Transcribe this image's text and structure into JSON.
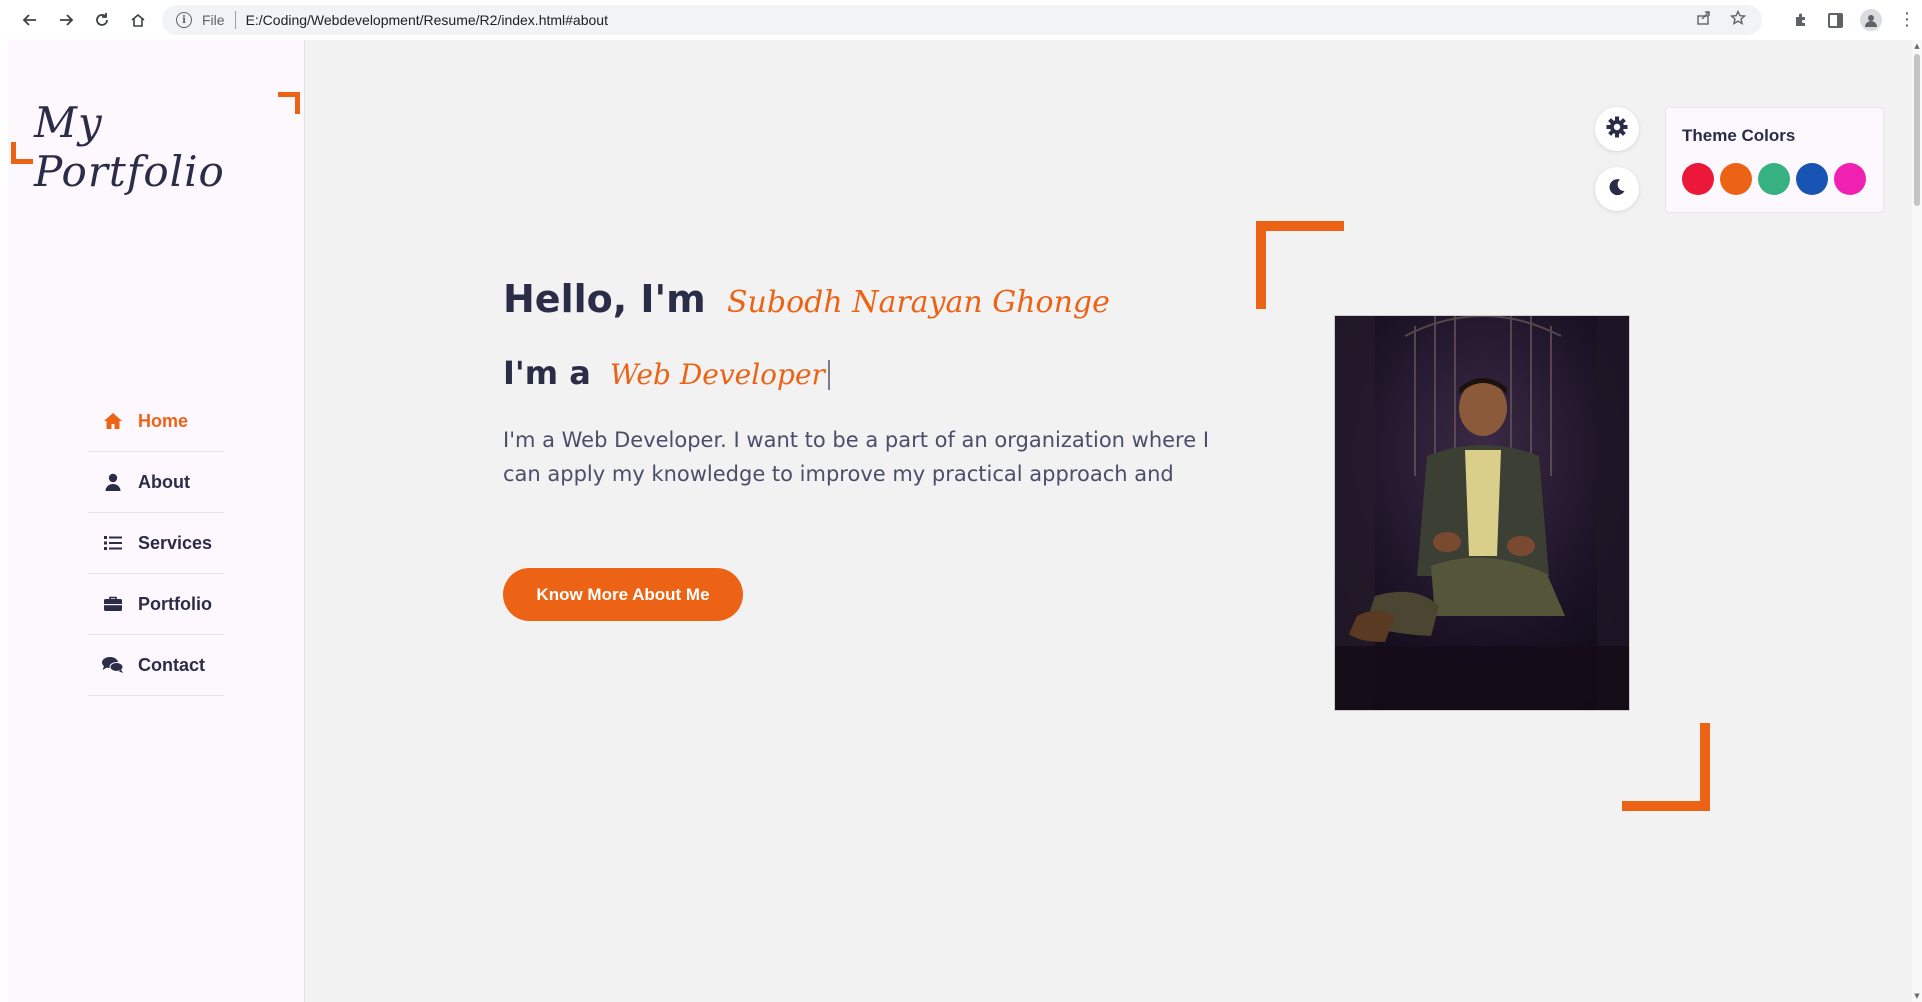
{
  "browser": {
    "scheme_label": "File",
    "url": "E:/Coding/Webdevelopment/Resume/R2/index.html#about"
  },
  "sidebar": {
    "logo": "My Portfolio",
    "items": [
      {
        "label": "Home",
        "icon": "home-icon",
        "active": true
      },
      {
        "label": "About",
        "icon": "user-icon",
        "active": false
      },
      {
        "label": "Services",
        "icon": "list-icon",
        "active": false
      },
      {
        "label": "Portfolio",
        "icon": "briefcase-icon",
        "active": false
      },
      {
        "label": "Contact",
        "icon": "comments-icon",
        "active": false
      }
    ]
  },
  "hero": {
    "greeting": "Hello, I'm",
    "name": "Subodh Narayan Ghonge",
    "role_prefix": "I'm a",
    "role": "Web Developer",
    "intro": "I'm a Web Developer. I want to be a part of an organization where I can apply my knowledge to improve my practical approach and",
    "cta_label": "Know More About Me"
  },
  "theme": {
    "title": "Theme Colors",
    "swatches": [
      "#ec1839",
      "#ec6316",
      "#37b182",
      "#1854b4",
      "#f021b2"
    ],
    "accent": "#ec6316"
  }
}
